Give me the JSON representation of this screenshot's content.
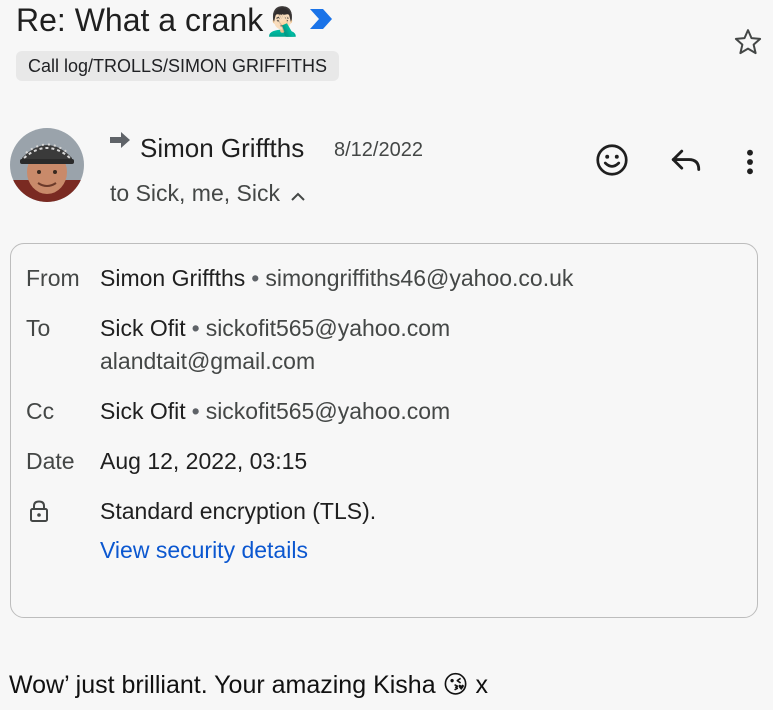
{
  "email": {
    "subject": "Re: What a crank",
    "subject_emoji": "🤦🏻‍♂️",
    "label": "Call log/TROLLS/SIMON GRIFFITHS",
    "sender_name": "Simon Griffths",
    "sender_date": "8/12/2022",
    "to_summary": "to Sick, me, Sick",
    "body": "Wow’ just brilliant. Your amazing Kisha 😘 x"
  },
  "details": {
    "from_label": "From",
    "from_name": "Simon Griffths",
    "from_addr": "simongriffiths46@yahoo.co.uk",
    "to_label": "To",
    "to_name": "Sick Ofit",
    "to_addr": "sickofit565@yahoo.com",
    "to_addr2": "alandtait@gmail.com",
    "cc_label": "Cc",
    "cc_name": "Sick Ofit",
    "cc_addr": "sickofit565@yahoo.com",
    "date_label": "Date",
    "date_value": "Aug 12, 2022, 03:15",
    "encryption": "Standard encryption (TLS).",
    "security_link": "View security details"
  },
  "icons": {
    "importance": "importance-marker-icon",
    "star": "star-icon",
    "forward": "forwarded-arrow-icon",
    "emoji_react": "smiley-icon",
    "reply": "reply-icon",
    "more": "more-vert-icon",
    "collapse": "chevron-up-icon",
    "lock": "lock-icon"
  },
  "colors": {
    "background": "#f7f7f7",
    "link": "#0b57d0",
    "importance": "#1a73e8",
    "border": "#bdbdbd",
    "chip": "#e8e8e8"
  }
}
